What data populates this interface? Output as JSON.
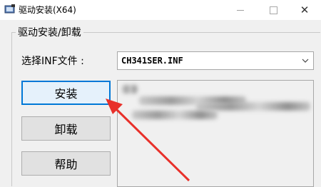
{
  "window": {
    "title": "驱动安装(X64)",
    "icons": {
      "app": "driver-app-icon",
      "minimize": "minimize-icon",
      "maximize": "maximize-icon",
      "close": "close-icon"
    }
  },
  "group": {
    "legend": "驱动安装/卸载",
    "select_label": "选择INF文件 :",
    "inf_file": "CH341SER.INF",
    "buttons": {
      "install": "安装",
      "uninstall": "卸载",
      "help": "帮助"
    }
  },
  "annotation": {
    "arrow_color": "#e8302a"
  },
  "colors": {
    "focus_border": "#0078d7"
  }
}
